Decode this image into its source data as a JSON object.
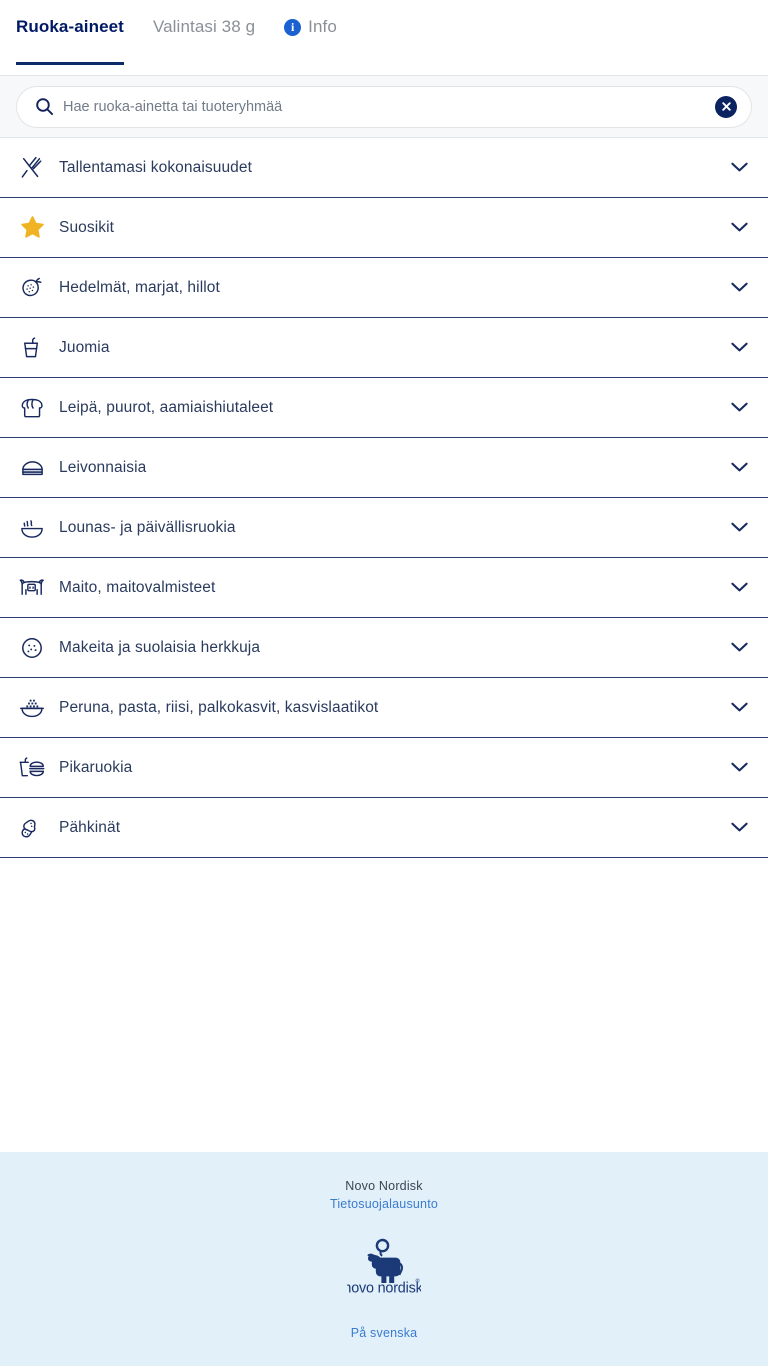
{
  "colors": {
    "brand_navy": "#001965",
    "line_navy": "#2a3f6e",
    "accent_blue": "#1b61d1",
    "link_blue": "#3a7bd0",
    "star_yellow": "#f0b323",
    "footer_bg": "#e2f0fa",
    "search_bg": "#f7f8f9"
  },
  "tabs": [
    {
      "label": "Ruoka-aineet",
      "active": true,
      "icon": ""
    },
    {
      "label": "Valintasi 38 g",
      "active": false,
      "icon": ""
    },
    {
      "label": "Info",
      "active": false,
      "icon": "info-circle-icon",
      "badge": "i"
    }
  ],
  "search": {
    "placeholder": "Hae ruoka-ainetta tai tuoteryhmää",
    "value": "",
    "icon": "search-icon",
    "clear_icon": "clear-circle-icon"
  },
  "categories": [
    {
      "label": "Tallentamasi kokonaisuudet",
      "icon": "fork-knife-icon",
      "chevron": "chevron-down-icon"
    },
    {
      "label": "Suosikit",
      "icon": "star-icon",
      "chevron": "chevron-down-icon"
    },
    {
      "label": "Hedelmät, marjat, hillot",
      "icon": "strawberry-icon",
      "chevron": "chevron-down-icon"
    },
    {
      "label": "Juomia",
      "icon": "drink-cup-icon",
      "chevron": "chevron-down-icon"
    },
    {
      "label": "Leipä, puurot, aamiaishiutaleet",
      "icon": "bread-loaf-icon",
      "chevron": "chevron-down-icon"
    },
    {
      "label": "Leivonnaisia",
      "icon": "cake-slice-icon",
      "chevron": "chevron-down-icon"
    },
    {
      "label": "Lounas- ja päivällisruokia",
      "icon": "soup-bowl-icon",
      "chevron": "chevron-down-icon"
    },
    {
      "label": "Maito, maitovalmisteet",
      "icon": "cow-icon",
      "chevron": "chevron-down-icon"
    },
    {
      "label": "Makeita ja suolaisia herkkuja",
      "icon": "cookie-icon",
      "chevron": "chevron-down-icon"
    },
    {
      "label": "Peruna, pasta, riisi, palkokasvit, kasvislaatikot",
      "icon": "rice-bowl-icon",
      "chevron": "chevron-down-icon"
    },
    {
      "label": "Pikaruokia",
      "icon": "fast-food-icon",
      "chevron": "chevron-down-icon"
    },
    {
      "label": "Pähkinät",
      "icon": "peanut-icon",
      "chevron": "chevron-down-icon"
    }
  ],
  "footer": {
    "company": "Novo Nordisk",
    "privacy_link": "Tietosuojalausunto",
    "logo_wordmark": "novo nordisk",
    "logo_registered": "®",
    "logo_icon": "novo-nordisk-apis-bull-icon",
    "language_link": "På svenska"
  }
}
